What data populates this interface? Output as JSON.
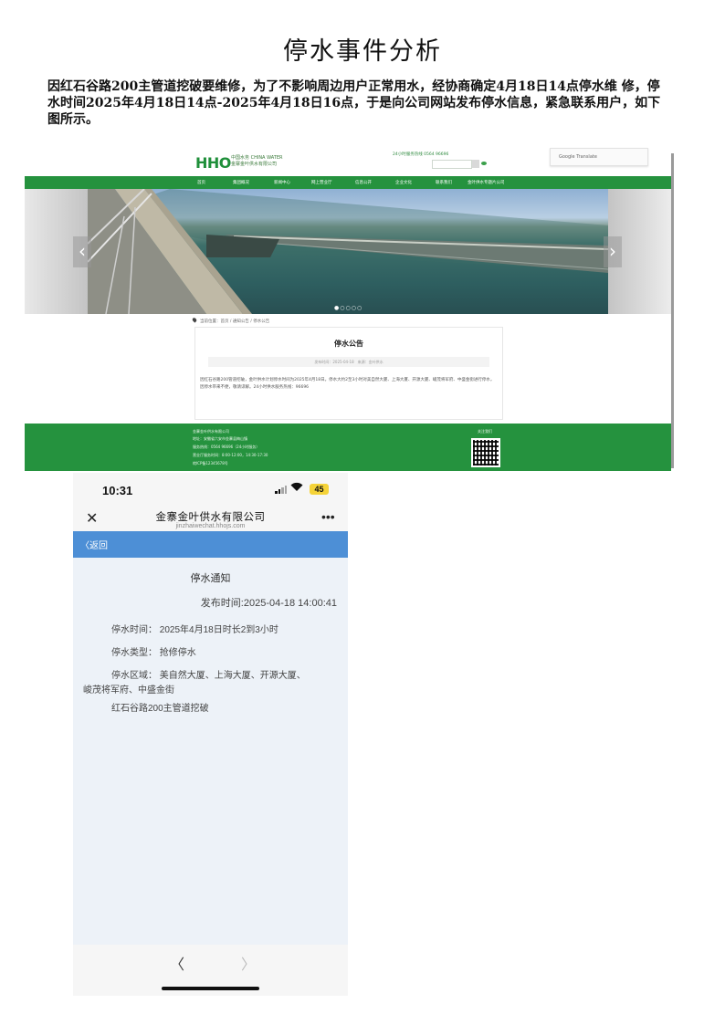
{
  "document": {
    "title": "停水事件分析",
    "intro": "因红石谷路200主管道挖破要维修，为了不影响周边用户正常用水，经协商确定4月18日14点停水维 修，停水时间2025年4月18日14点-2025年4月18日16点，于是向公司网站发布停水信息，紧急联系用户，如下图所示。"
  },
  "website": {
    "logo": "HHO",
    "logo_sub1": "中国水务 CHINA WATER",
    "logo_sub2": "金寨金叶供水有限公司",
    "hotline": "24小时服务热线 0564 96696",
    "translate": "Google Translate",
    "nav": [
      "首页",
      "集团概况",
      "新闻中心",
      "网上营业厅",
      "信息公开",
      "企业文化",
      "联系我们",
      "金叶供水专题片公司"
    ],
    "breadcrumb": "当前位置：首页 / 通知公告 / 停水公告",
    "notice_title": "停水公告",
    "notice_meta": "发布时间：2025-04-18　来源：金叶供水",
    "notice_body": "因红石谷路200管道挖破，金叶供水计划停水时间为2025年4月18日。停水大约2至3小时对美自然大厦、上海大厦、开源大厦、峻茂将军府、中盛金街进行停水，因停水带来不便，敬请谅解。24小时供水服务热线：96696",
    "footer_lines": [
      "金寨金叶供水有限公司",
      "地址：安徽省六安市金寨县梅山镇",
      "服务热线：0564 96696（24小时服务）",
      "营业厅服务时间：8:00-12:00，14:30-17:30",
      "皖ICP备12345678号"
    ],
    "qr_label": "关注我们"
  },
  "phone": {
    "status_time": "10:31",
    "battery": "45",
    "app_title": "金寨金叶供水有限公司",
    "app_domain": "jinzhaiwechat.hhojs.com",
    "back_label": "返回",
    "notice_title": "停水通知",
    "publish_time": "发布时间:2025-04-18 14:00:41",
    "rows": {
      "time": "停水时间：  2025年4月18日时长2到3小时",
      "type": "停水类型：  抢修停水",
      "area_1": "停水区域：  美自然大厦、上海大厦、开源大厦、",
      "area_2": "峻茂将军府、中盛金街",
      "cause": "红石谷路200主管道挖破"
    }
  }
}
